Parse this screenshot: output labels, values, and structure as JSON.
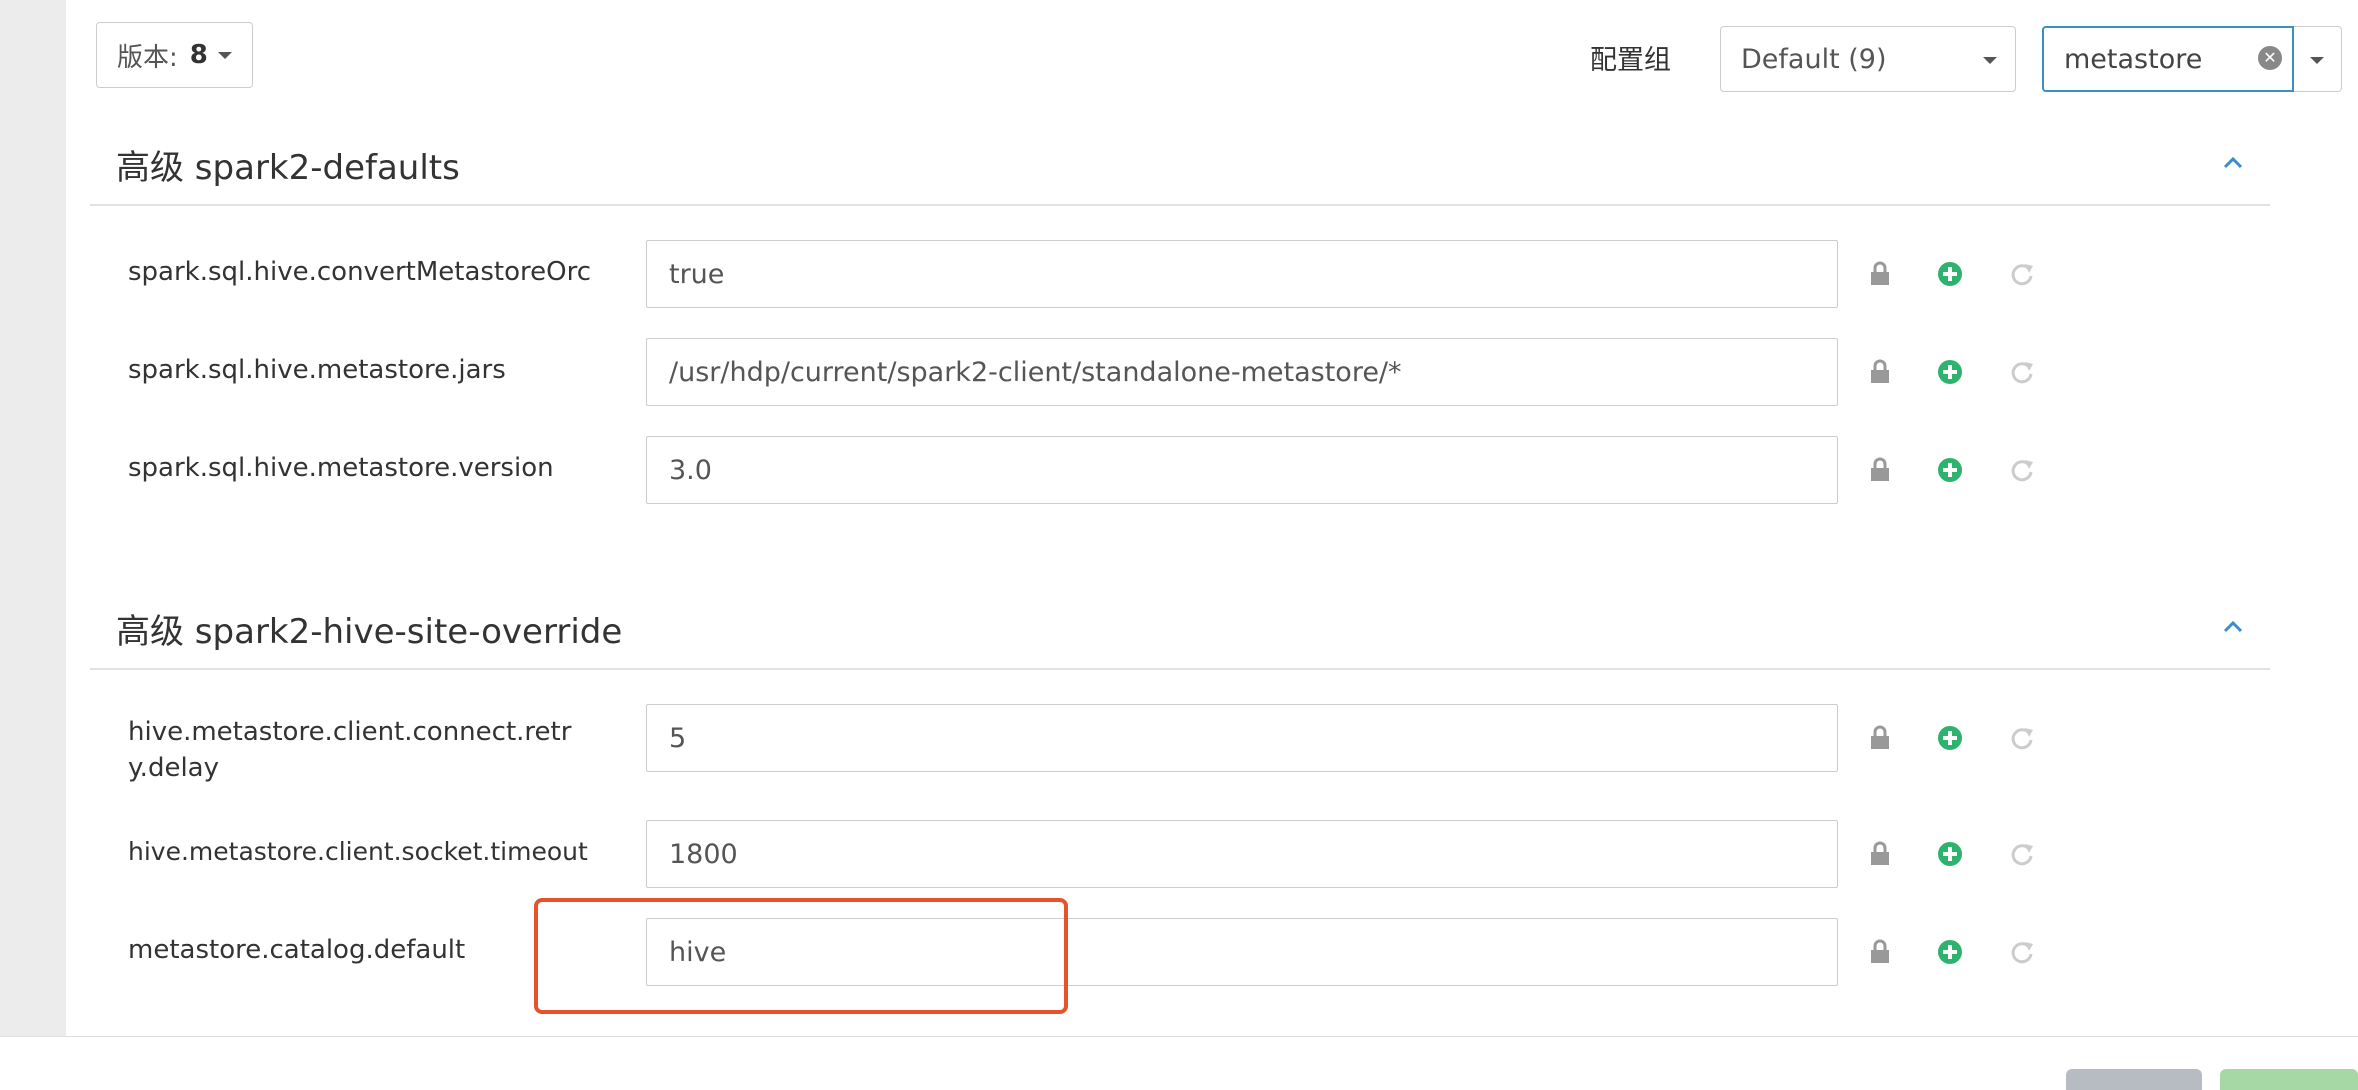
{
  "toolbar": {
    "version_label": "版本:",
    "version_value": "8",
    "config_group_label": "配置组",
    "config_group_value": "Default (9)",
    "search_value": "metastore"
  },
  "sections": [
    {
      "title": "高级 spark2-defaults",
      "properties": [
        {
          "name": "spark.sql.hive.convertMetastoreOrc",
          "value": "true"
        },
        {
          "name": "spark.sql.hive.metastore.jars",
          "value": "/usr/hdp/current/spark2-client/standalone-metastore/*"
        },
        {
          "name": "spark.sql.hive.metastore.version",
          "value": "3.0"
        }
      ]
    },
    {
      "title": "高级 spark2-hive-site-override",
      "properties": [
        {
          "name": "hive.metastore.client.connect.retry.delay",
          "value": "5"
        },
        {
          "name": "hive.metastore.client.socket.timeout",
          "value": "1800"
        },
        {
          "name": "metastore.catalog.default",
          "value": "hive"
        }
      ]
    }
  ],
  "colors": {
    "accent": "#3a8fc8",
    "add_green": "#2db36e",
    "highlight": "#e5532c"
  },
  "icons": {
    "lock": "lock-icon",
    "add": "plus-circle-icon",
    "undo": "undo-icon"
  }
}
